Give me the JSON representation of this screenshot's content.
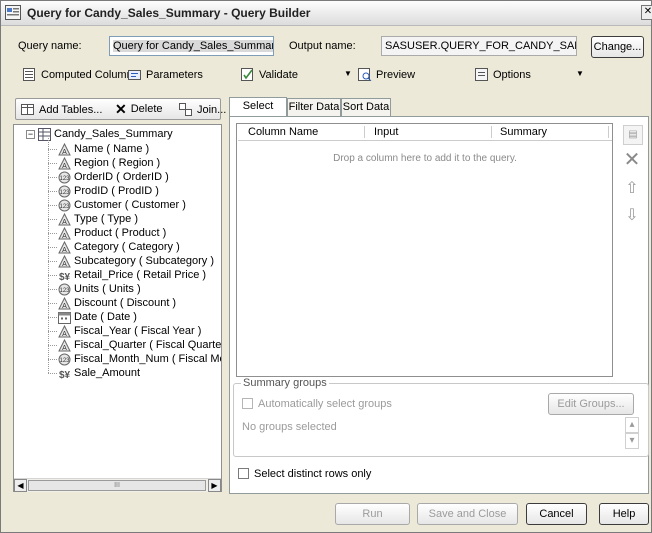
{
  "window": {
    "title": "Query for Candy_Sales_Summary - Query Builder"
  },
  "header": {
    "query_name_label": "Query name:",
    "query_name_value": "Query for Candy_Sales_Summary",
    "output_name_label": "Output name:",
    "output_name_value": "SASUSER.QUERY_FOR_CANDY_SALES_S",
    "change_button": "Change..."
  },
  "toolbar": {
    "computed_columns": "Computed Columns",
    "parameters": "Parameters",
    "validate": "Validate",
    "preview": "Preview",
    "options": "Options"
  },
  "left_toolbar": {
    "add_tables": "Add Tables...",
    "delete": "Delete",
    "join": "Join..."
  },
  "tree": {
    "root": "Candy_Sales_Summary",
    "items": [
      {
        "label": "Name ( Name )",
        "icon": "char-icon"
      },
      {
        "label": "Region ( Region )",
        "icon": "char-icon"
      },
      {
        "label": "OrderID ( OrderID )",
        "icon": "numeric-icon"
      },
      {
        "label": "ProdID ( ProdID )",
        "icon": "numeric-icon"
      },
      {
        "label": "Customer ( Customer )",
        "icon": "numeric-icon"
      },
      {
        "label": "Type ( Type )",
        "icon": "char-icon"
      },
      {
        "label": "Product ( Product )",
        "icon": "char-icon"
      },
      {
        "label": "Category ( Category )",
        "icon": "char-icon"
      },
      {
        "label": "Subcategory ( Subcategory )",
        "icon": "char-icon"
      },
      {
        "label": "Retail_Price ( Retail Price )",
        "icon": "currency-icon"
      },
      {
        "label": "Units ( Units )",
        "icon": "numeric-icon"
      },
      {
        "label": "Discount ( Discount )",
        "icon": "char-icon"
      },
      {
        "label": "Date ( Date )",
        "icon": "date-icon"
      },
      {
        "label": "Fiscal_Year ( Fiscal Year )",
        "icon": "char-icon"
      },
      {
        "label": "Fiscal_Quarter ( Fiscal Quarter )",
        "icon": "char-icon"
      },
      {
        "label": "Fiscal_Month_Num ( Fiscal Month N",
        "icon": "numeric-icon"
      },
      {
        "label": "Sale_Amount",
        "icon": "currency-icon"
      }
    ]
  },
  "tabs": [
    "Select Data",
    "Filter Data",
    "Sort Data"
  ],
  "columns": {
    "name": "Column Name",
    "input": "Input",
    "summary": "Summary"
  },
  "drop_hint": "Drop a column here to add it to the query.",
  "summary_groups": {
    "legend": "Summary groups",
    "auto_select": "Automatically select groups",
    "edit_groups": "Edit Groups...",
    "no_groups": "No groups selected"
  },
  "distinct_rows": "Select distinct rows only",
  "footer": {
    "run": "Run",
    "save_close": "Save and Close",
    "cancel": "Cancel",
    "help": "Help"
  },
  "scrollbar": {
    "thumb_text": "III"
  }
}
